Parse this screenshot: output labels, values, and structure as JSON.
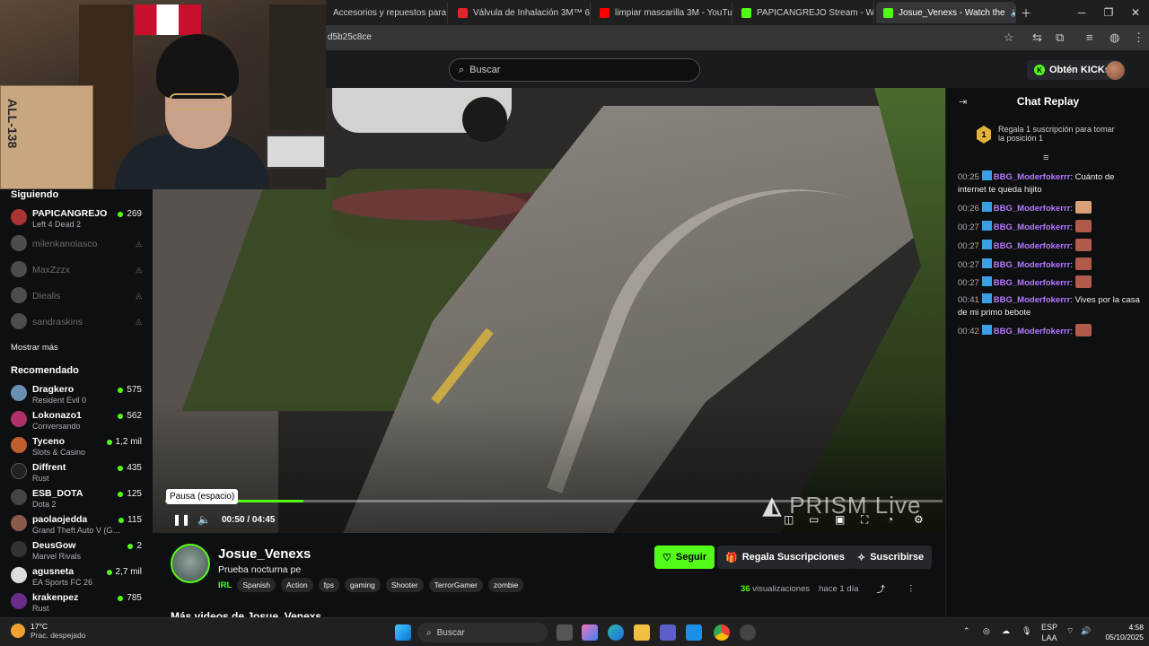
{
  "browser": {
    "tabs": [
      {
        "label": "Accesorios y repuestos para re",
        "color": "#6a6a6a"
      },
      {
        "label": "Válvula de Inhalación 3M™ 68",
        "color": "#e0242a"
      },
      {
        "label": "limpiar mascarilla 3M - YouTub",
        "color": "#ff0000"
      },
      {
        "label": "PAPICANGREJO Stream - Watc",
        "color": "#53fc18"
      },
      {
        "label": "Josue_Venexs - Watch the",
        "color": "#53fc18"
      }
    ],
    "url": "d5b25c8ce"
  },
  "header": {
    "search_placeholder": "Buscar",
    "kicks_label": "Obtén KICKs"
  },
  "webcam": {
    "box_text": "ALL-138"
  },
  "sidebar": {
    "following_title": "Siguiendo",
    "following": [
      {
        "name": "PAPICANGREJO",
        "sub": "Left 4 Dead 2",
        "viewers": "269",
        "live": true,
        "color": "#a33"
      },
      {
        "name": "milenkanolasco",
        "live": false,
        "color": "#999"
      },
      {
        "name": "MaxZzzx",
        "live": false,
        "color": "#999"
      },
      {
        "name": "Diealis",
        "live": false,
        "color": "#999"
      },
      {
        "name": "sandraskins",
        "live": false,
        "color": "#999"
      }
    ],
    "show_more": "Mostrar más",
    "recommended_title": "Recomendado",
    "recommended": [
      {
        "name": "Dragkero",
        "sub": "Resident Evil 0",
        "viewers": "575",
        "color": "#6a8fb0"
      },
      {
        "name": "Lokonazo1",
        "sub": "Conversando",
        "viewers": "562",
        "color": "#b0306a"
      },
      {
        "name": "Tyceno",
        "sub": "Slots & Casino",
        "viewers": "1,2 mil",
        "color": "#c06030"
      },
      {
        "name": "Diffrent",
        "sub": "Rust",
        "viewers": "435",
        "color": "#222"
      },
      {
        "name": "ESB_DOTA",
        "sub": "Dota 2",
        "viewers": "125",
        "color": "#444"
      },
      {
        "name": "paolaojedda",
        "sub": "Grand Theft Auto V (GT...",
        "viewers": "115",
        "color": "#8a5a4a"
      },
      {
        "name": "DeusGow",
        "sub": "Marvel Rivals",
        "viewers": "2",
        "color": "#333"
      },
      {
        "name": "agusneta",
        "sub": "EA Sports FC 26",
        "viewers": "2,7 mil",
        "color": "#ddd"
      },
      {
        "name": "krakenpez",
        "sub": "Rust",
        "viewers": "785",
        "color": "#6a2a8a"
      }
    ]
  },
  "video": {
    "watermark_main": "PRISM",
    "watermark_sub": "Live",
    "tooltip": "Pausa (espacio)",
    "current_time": "00:50",
    "duration": "04:45",
    "progress": 0.178
  },
  "chat": {
    "title": "Chat Replay",
    "gift_rank": "1",
    "gift_text": "Regala 1 suscripción para tomar la posición 1",
    "messages": [
      {
        "time": "00:25",
        "user": "BBG_Moderfokerrr",
        "text": "Cuánto de internet te queda hijito"
      },
      {
        "time": "00:26",
        "user": "BBG_Moderfokerrr",
        "text": ""
      },
      {
        "time": "00:27",
        "user": "BBG_Moderfokerrr",
        "text": ""
      },
      {
        "time": "00:27",
        "user": "BBG_Moderfokerrr",
        "text": ""
      },
      {
        "time": "00:27",
        "user": "BBG_Moderfokerrr",
        "text": ""
      },
      {
        "time": "00:27",
        "user": "BBG_Moderfokerrr",
        "text": ""
      },
      {
        "time": "00:41",
        "user": "BBG_Moderfokerrr",
        "text": "Vives por la casa de mi primo bebote"
      },
      {
        "time": "00:42",
        "user": "BBG_Moderfokerrr",
        "text": ""
      }
    ]
  },
  "channel": {
    "name": "Josue_Venexs",
    "title": "Prueba nocturna pe",
    "category": "IRL",
    "tags": [
      "Spanish",
      "Action",
      "fps",
      "gaming",
      "Shooter",
      "TerrorGamer",
      "zombie"
    ],
    "follow_label": "Seguir",
    "gift_label": "Regala Suscripciones",
    "subscribe_label": "Suscribirse",
    "views_count": "36",
    "views_label": "visualizaciones",
    "date": "hace 1 día",
    "more_videos": "Más videos de Josue_Venexs"
  },
  "taskbar": {
    "temp": "17°C",
    "weather": "Prac. despejado",
    "search": "Buscar",
    "lang": "ESP",
    "lang_sub": "LAA",
    "time": "4:58",
    "date": "05/10/2025"
  }
}
